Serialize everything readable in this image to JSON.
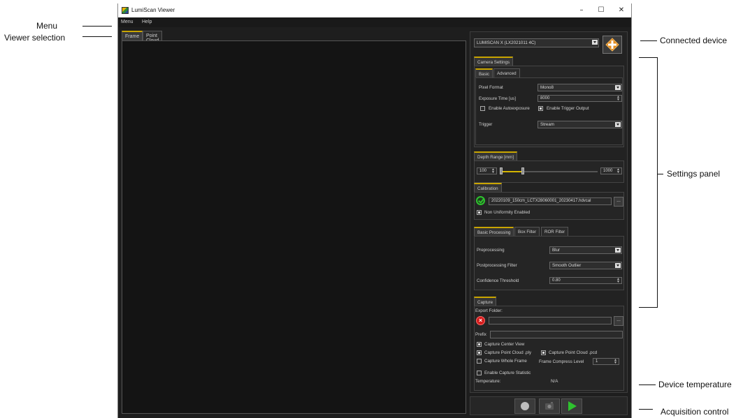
{
  "window": {
    "title": "LumiScan Viewer",
    "controls": {
      "minimize": "–",
      "maximize": "☐",
      "close": "✕"
    }
  },
  "menubar": {
    "items": [
      "Menu",
      "Help"
    ]
  },
  "viewer_tabs": {
    "items": [
      "Frame",
      "Point Cloud"
    ],
    "active": 0
  },
  "device": {
    "selected": "LUMISCAN X (LX2021011 4C)"
  },
  "camera_settings": {
    "group_label": "Camera Settings",
    "tabs": [
      "Basic",
      "Advanced"
    ],
    "pixel_format_label": "Pixel Format",
    "pixel_format_value": "Mono8",
    "exposure_label": "Exposure Time [us]",
    "exposure_value": "8000",
    "autoexposure_label": "Enable Autoexposure",
    "trigger_output_label": "Enable Trigger Output",
    "trigger_label": "Trigger",
    "trigger_value": "Stream"
  },
  "depth_range": {
    "label": "Depth Range [mm]",
    "min_value": "100",
    "max_value": "1000",
    "range_start_fraction": 0.0,
    "range_end_fraction": 0.22
  },
  "calibration": {
    "label": "Calibration",
    "file": "20220109_150cm_LCTX28060001_20230417.hdvcal",
    "non_uniformity_label": "Non Uniformity Enabled",
    "browse_label": "..."
  },
  "processing": {
    "tabs": [
      "Basic Processing",
      "Box Filter",
      "ROR Filter"
    ],
    "preprocessing_label": "Preprocessing",
    "preprocessing_value": "Blur",
    "postprocessing_label": "Postprocessing Filter",
    "postprocessing_value": "Smooth Outlier",
    "confidence_label": "Confidence Threshold",
    "confidence_value": "0.80"
  },
  "capture": {
    "label": "Capture",
    "export_folder_label": "Export Folder:",
    "export_folder_value": "",
    "browse_label": "...",
    "prefix_label": "Prefix",
    "prefix_value": "",
    "center_view_label": "Capture Center View",
    "ply_label": "Capture Point Cloud .ply",
    "pcd_label": "Capture Point Cloud .pcd",
    "whole_frame_label": "Capture Whole Frame",
    "compress_label": "Frame Compress Level",
    "compress_value": "1",
    "statistic_label": "Enable Capture Statistic",
    "temperature_label": "Temperature:",
    "temperature_value": "N/A"
  },
  "annotations": {
    "menu": "Menu",
    "viewer_selection": "Viewer selection",
    "connected_device": "Connected device",
    "settings_panel": "Settings panel",
    "device_temperature": "Device temperature",
    "acquisition_control": "Acquisition control"
  },
  "colors": {
    "accent": "#c9a500",
    "background": "#1e1e1e",
    "play": "#2ec22e",
    "error": "#d41c1c"
  }
}
